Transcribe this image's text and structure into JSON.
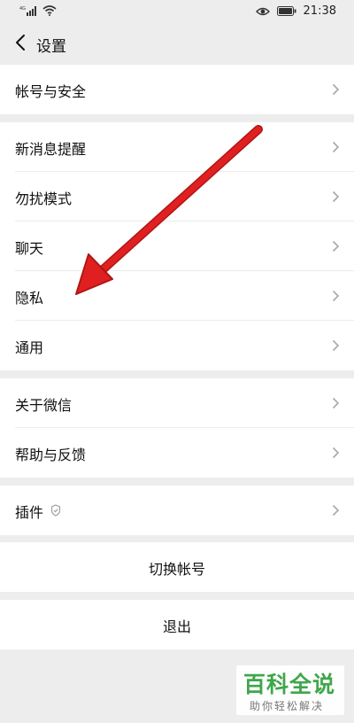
{
  "status": {
    "time": "21:38"
  },
  "nav": {
    "title": "设置"
  },
  "groups": {
    "account": {
      "items": [
        {
          "label": "帐号与安全"
        }
      ]
    },
    "prefs": {
      "items": [
        {
          "label": "新消息提醒"
        },
        {
          "label": "勿扰模式"
        },
        {
          "label": "聊天"
        },
        {
          "label": "隐私"
        },
        {
          "label": "通用"
        }
      ]
    },
    "about": {
      "items": [
        {
          "label": "关于微信"
        },
        {
          "label": "帮助与反馈"
        }
      ]
    },
    "plugins": {
      "items": [
        {
          "label": "插件"
        }
      ]
    }
  },
  "actions": {
    "switch_account": "切换帐号",
    "logout": "退出"
  },
  "watermark": {
    "title": "百科全说",
    "subtitle": "助你轻松解决"
  },
  "colors": {
    "background": "#ededed",
    "card": "#ffffff",
    "arrow": "#e02020",
    "watermark_green": "#3fa64b"
  }
}
